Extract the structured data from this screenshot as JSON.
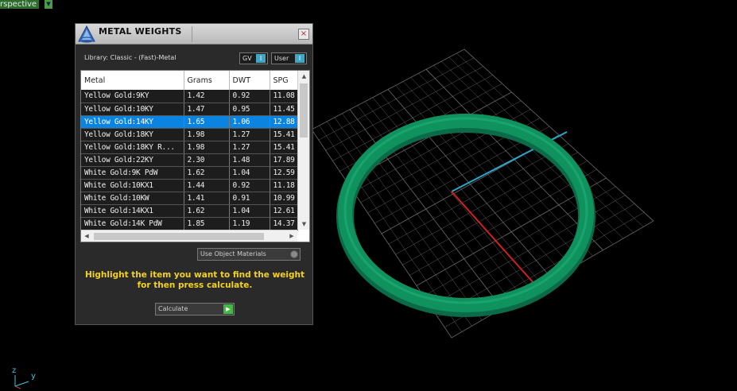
{
  "viewport": {
    "label": "rspective",
    "axes": {
      "z": "z",
      "y": "y"
    },
    "ring_color": "#0e8a5e",
    "grid_color": "#7a7a7a"
  },
  "dialog": {
    "title": "METAL WEIGHTS",
    "close_glyph": "×",
    "library": "Library: Classic - (Fast)-Metal",
    "toggles": {
      "gv": "GV",
      "user": "User"
    },
    "columns": [
      "Metal",
      "Grams",
      "DWT",
      "SPG"
    ],
    "rows": [
      {
        "metal": "Yellow Gold:9KY",
        "grams": "1.42",
        "dwt": "0.92",
        "spg": "11.08"
      },
      {
        "metal": "Yellow Gold:10KY",
        "grams": "1.47",
        "dwt": "0.95",
        "spg": "11.45"
      },
      {
        "metal": "Yellow Gold:14KY",
        "grams": "1.65",
        "dwt": "1.06",
        "spg": "12.88"
      },
      {
        "metal": "Yellow Gold:18KY",
        "grams": "1.98",
        "dwt": "1.27",
        "spg": "15.41"
      },
      {
        "metal": "Yellow Gold:18KY R...",
        "grams": "1.98",
        "dwt": "1.27",
        "spg": "15.41"
      },
      {
        "metal": "Yellow Gold:22KY",
        "grams": "2.30",
        "dwt": "1.48",
        "spg": "17.89"
      },
      {
        "metal": "White Gold:9K PdW",
        "grams": "1.62",
        "dwt": "1.04",
        "spg": "12.59"
      },
      {
        "metal": "White Gold:10KX1",
        "grams": "1.44",
        "dwt": "0.92",
        "spg": "11.18"
      },
      {
        "metal": "White Gold:10KW",
        "grams": "1.41",
        "dwt": "0.91",
        "spg": "10.99"
      },
      {
        "metal": "White Gold:14KX1",
        "grams": "1.62",
        "dwt": "1.04",
        "spg": "12.61"
      },
      {
        "metal": "White Gold:14K PdW",
        "grams": "1.85",
        "dwt": "1.19",
        "spg": "14.37"
      }
    ],
    "selected_row": 2,
    "use_object_materials": "Use Object Materials",
    "instructions_line1": "Highlight the item you want to find the weight",
    "instructions_line2": "for then press calculate.",
    "calculate_label": "Calculate",
    "selection_color": "#0a84e0",
    "instruction_color": "#f3d21b"
  }
}
